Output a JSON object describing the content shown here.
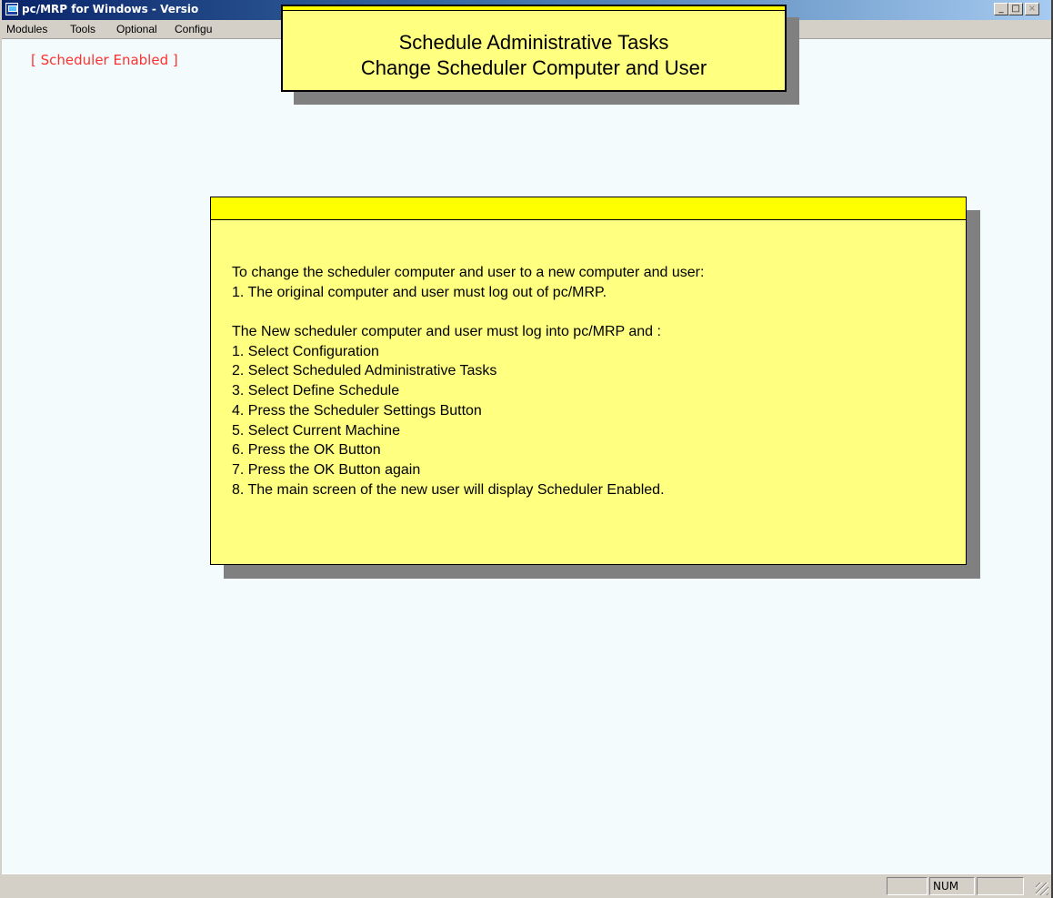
{
  "window": {
    "title": "pc/MRP for Windows - Versio",
    "controls": {
      "minimize": "_",
      "maximize": "□",
      "close": "×"
    }
  },
  "menubar": {
    "items": [
      "Modules",
      "Tools",
      "Optional",
      "Configu"
    ]
  },
  "status": {
    "scheduler": "[ Scheduler Enabled ]"
  },
  "title_box": {
    "line1": "Schedule Administrative Tasks",
    "line2": "Change Scheduler Computer and User"
  },
  "note": {
    "lines": [
      "To change the scheduler computer and user to a new computer and user:",
      "1. The original computer and user must log out of pc/MRP.",
      "",
      "The New scheduler computer and user must log into pc/MRP and :",
      "1. Select Configuration",
      "2. Select Scheduled Administrative Tasks",
      "3. Select Define Schedule",
      "4. Press the Scheduler Settings Button",
      "5. Select Current Machine",
      "6. Press the OK Button",
      "7. Press the OK Button again",
      "8. The main screen of the new user will display Scheduler Enabled."
    ]
  },
  "statusbar": {
    "panels": [
      "",
      "NUM",
      ""
    ]
  }
}
